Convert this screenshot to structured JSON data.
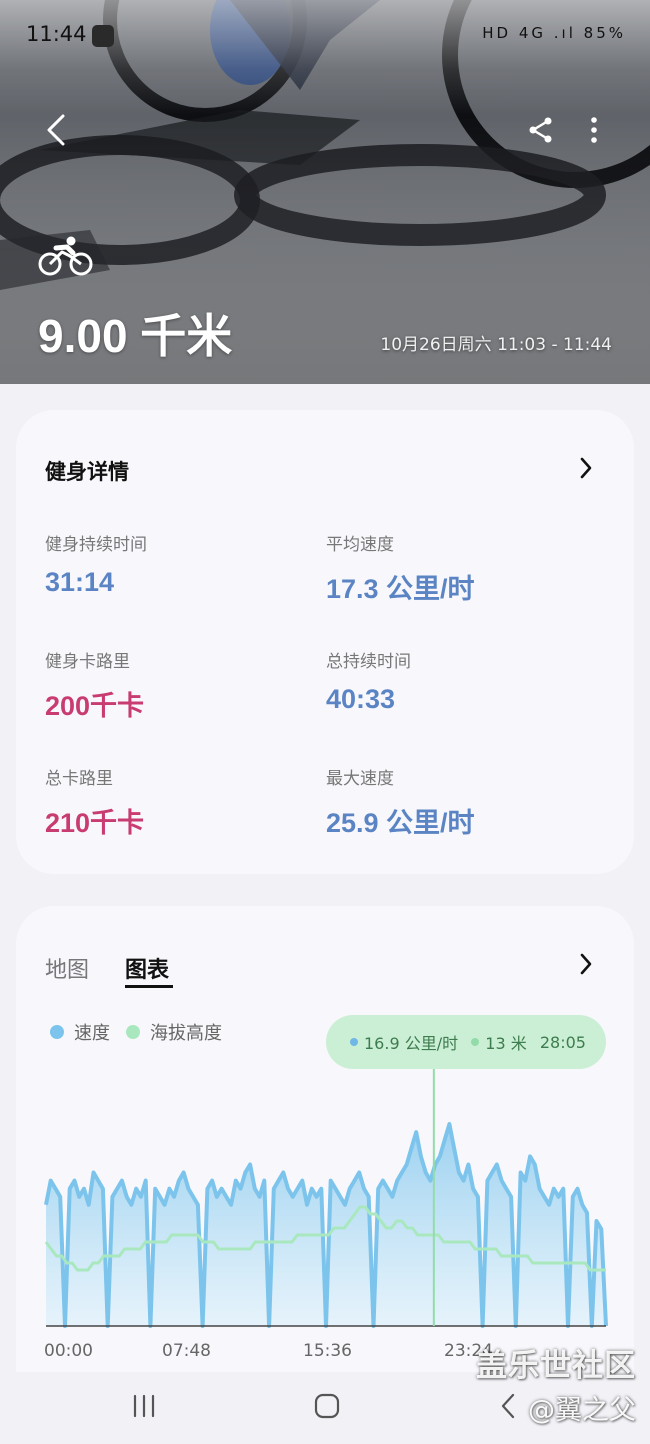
{
  "status_bar": {
    "time": "11:44",
    "indicators": "HD 4G .ıl 85%"
  },
  "header": {
    "activity_icon": "cycling-icon",
    "distance": "9.00 千米",
    "date_range": "10月26日周六 11:03 - 11:44"
  },
  "details": {
    "title": "健身详情",
    "stats": [
      {
        "label": "健身持续时间",
        "value": "31:14",
        "color": "#5b84c4"
      },
      {
        "label": "平均速度",
        "value": "17.3 公里/时",
        "color": "#5b84c4"
      },
      {
        "label": "健身卡路里",
        "value": "200千卡",
        "color": "#c83c72"
      },
      {
        "label": "总持续时间",
        "value": "40:33",
        "color": "#5b84c4"
      },
      {
        "label": "总卡路里",
        "value": "210千卡",
        "color": "#c83c72"
      },
      {
        "label": "最大速度",
        "value": "25.9 公里/时",
        "color": "#5b84c4"
      }
    ]
  },
  "chart_section": {
    "tabs": [
      {
        "label": "地图",
        "active": false
      },
      {
        "label": "图表",
        "active": true
      }
    ],
    "legend": [
      {
        "label": "速度",
        "color": "#7cc4ec"
      },
      {
        "label": "海拔高度",
        "color": "#a9e8be"
      }
    ],
    "tooltip": {
      "speed": "16.9 公里/时",
      "altitude": "13 米",
      "time": "28:05"
    }
  },
  "chart_data": {
    "type": "area",
    "x_tick_labels": [
      "00:00",
      "07:48",
      "15:36",
      "23:24"
    ],
    "series": [
      {
        "name": "速度",
        "color": "#7cc4ec",
        "values": [
          15,
          18,
          17,
          16,
          0,
          17,
          18,
          16,
          17,
          15,
          19,
          18,
          17,
          0,
          16,
          17,
          18,
          16,
          15,
          17,
          16,
          18,
          0,
          17,
          16,
          15,
          17,
          16,
          18,
          19,
          17,
          16,
          15,
          0,
          17,
          18,
          16,
          17,
          16,
          15,
          18,
          17,
          19,
          20,
          17,
          16,
          18,
          0,
          17,
          18,
          19,
          17,
          16,
          17,
          18,
          15,
          17,
          16,
          17,
          0,
          18,
          17,
          16,
          15,
          17,
          18,
          19,
          17,
          16,
          0,
          17,
          18,
          17,
          16,
          18,
          19,
          20,
          22,
          24,
          21,
          19,
          18,
          20,
          21,
          23,
          25,
          22,
          19,
          18,
          20,
          17,
          16,
          0,
          18,
          19,
          20,
          18,
          17,
          16,
          0,
          19,
          18,
          21,
          20,
          17,
          16,
          15,
          17,
          16,
          17,
          0,
          16,
          17,
          15,
          14,
          0,
          13,
          12,
          0
        ],
        "y_range": [
          0,
          26
        ]
      },
      {
        "name": "海拔高度",
        "color": "#a9e8be",
        "values": [
          12,
          11,
          10,
          10,
          9,
          9,
          8,
          8,
          8,
          9,
          9,
          10,
          10,
          10,
          10,
          11,
          11,
          11,
          11,
          12,
          12,
          12,
          12,
          12,
          13,
          13,
          13,
          13,
          13,
          13,
          12,
          12,
          12,
          11,
          11,
          11,
          11,
          11,
          11,
          11,
          12,
          12,
          12,
          12,
          12,
          12,
          12,
          12,
          13,
          13,
          13,
          13,
          13,
          13,
          13,
          14,
          14,
          14,
          15,
          16,
          17,
          17,
          16,
          16,
          15,
          14,
          14,
          15,
          15,
          14,
          14,
          13,
          13,
          13,
          13,
          13,
          12,
          12,
          12,
          12,
          12,
          12,
          11,
          11,
          11,
          11,
          11,
          10,
          10,
          10,
          10,
          10,
          10,
          9,
          9,
          9,
          9,
          9,
          9,
          9,
          9,
          9,
          9,
          9,
          8,
          8,
          8,
          8
        ],
        "y_range": [
          0,
          30
        ]
      }
    ]
  },
  "nav": {
    "recent_icon": "recent-apps-icon",
    "home_icon": "home-icon",
    "back_icon": "back-icon"
  },
  "watermark": {
    "line1": "盖乐世社区",
    "line2": "@翼之父"
  }
}
